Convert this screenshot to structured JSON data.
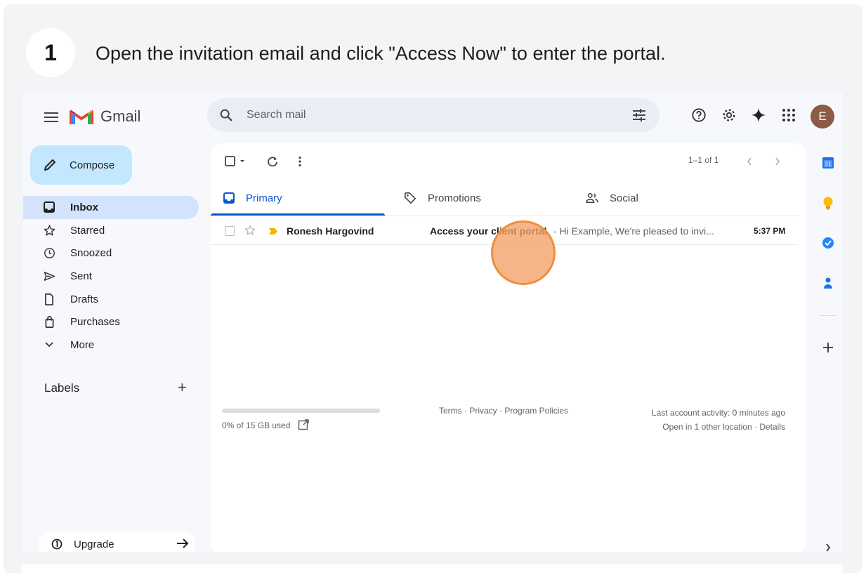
{
  "step": {
    "number": "1",
    "text": "Open the invitation email and click \"Access Now\" to enter the portal."
  },
  "header": {
    "brand": "Gmail",
    "search_placeholder": "Search mail",
    "avatar_letter": "E"
  },
  "sidebar": {
    "compose_label": "Compose",
    "items": [
      {
        "label": "Inbox",
        "icon": "inbox-icon",
        "active": true
      },
      {
        "label": "Starred",
        "icon": "star-icon"
      },
      {
        "label": "Snoozed",
        "icon": "clock-icon"
      },
      {
        "label": "Sent",
        "icon": "send-icon"
      },
      {
        "label": "Drafts",
        "icon": "draft-icon"
      },
      {
        "label": "Purchases",
        "icon": "bag-icon"
      },
      {
        "label": "More",
        "icon": "chevron-down-icon"
      }
    ],
    "labels_heading": "Labels",
    "upgrade_label": "Upgrade"
  },
  "toolbar": {
    "page_count": "1–1 of 1"
  },
  "tabs": [
    {
      "label": "Primary",
      "icon": "inbox-icon",
      "active": true
    },
    {
      "label": "Promotions",
      "icon": "tag-icon"
    },
    {
      "label": "Social",
      "icon": "people-icon"
    }
  ],
  "emails": [
    {
      "sender": "Ronesh Hargovind",
      "subject": "Access your client portal",
      "snippet": " - Hi Example, We're pleased to invi...",
      "time": "5:37 PM"
    }
  ],
  "footer": {
    "storage": "0% of 15 GB used",
    "storage_fraction": 0,
    "links": "Terms · Privacy · Program Policies",
    "activity_line1": "Last account activity: 0 minutes ago",
    "activity_line2": "Open in 1 other location · Details"
  },
  "side_panel": {
    "calendar_day": "31"
  },
  "colors": {
    "accent": "#0b57d0",
    "compose_bg": "#c2e7ff",
    "active_nav": "#d3e3fd",
    "click_marker": "#f4a066"
  }
}
